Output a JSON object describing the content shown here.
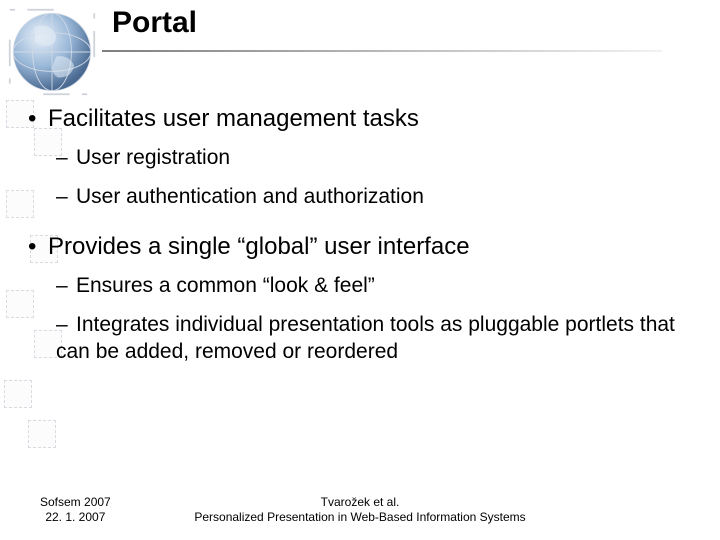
{
  "title": "Portal",
  "bullets": [
    {
      "text": "Facilitates user management tasks",
      "sub": [
        "User registration",
        "User authentication and authorization"
      ]
    },
    {
      "text": "Provides a single “global” user interface",
      "sub": [
        "Ensures a common “look & feel”",
        "Integrates individual presentation tools as pluggable portlets that can be added, removed or reordered"
      ]
    }
  ],
  "footer": {
    "left_line1": "Sofsem 2007",
    "left_line2": "22. 1. 2007",
    "center_line1": "Tvarožek et al.",
    "center_line2": "Personalized Presentation in Web-Based Information Systems"
  }
}
